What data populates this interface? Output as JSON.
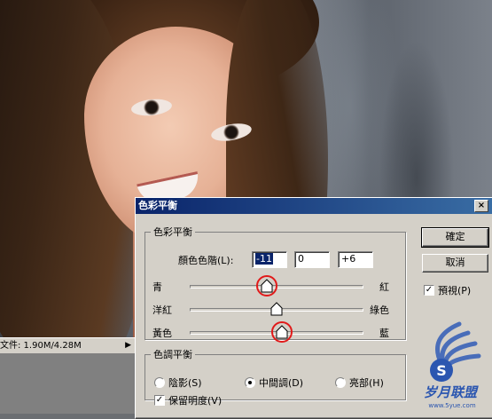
{
  "status": {
    "doc_size": "文件: 1.90M/4.28M",
    "arrow": "▶"
  },
  "dialog": {
    "title": "色彩平衡",
    "close": "×",
    "balance_group": {
      "legend": "色彩平衡",
      "levels_label": "顏色色階(L):",
      "levels": [
        "-11",
        "0",
        "+6"
      ],
      "sliders": [
        {
          "left": "青",
          "right": "紅",
          "value": -11
        },
        {
          "left": "洋紅",
          "right": "綠色",
          "value": 0
        },
        {
          "left": "黃色",
          "right": "藍",
          "value": 6
        }
      ],
      "slider_range": [
        -100,
        100
      ]
    },
    "tone_group": {
      "legend": "色調平衡",
      "options": [
        "陰影(S)",
        "中間調(D)",
        "亮部(H)"
      ],
      "selected": 1,
      "preserve_luminosity": "保留明度(V)",
      "preserve_checked": true
    },
    "buttons": {
      "ok": "確定",
      "cancel": "取消"
    },
    "preview": {
      "label": "預視(P)",
      "checked": true
    }
  },
  "watermark": {
    "text": "岁月联盟",
    "url": "www.5yue.com",
    "letter": "S"
  },
  "colors": {
    "title_start": "#0a246a",
    "title_end": "#3a6ea5",
    "highlight": "#e11a1a",
    "dialog_bg": "#d4d0c8"
  }
}
